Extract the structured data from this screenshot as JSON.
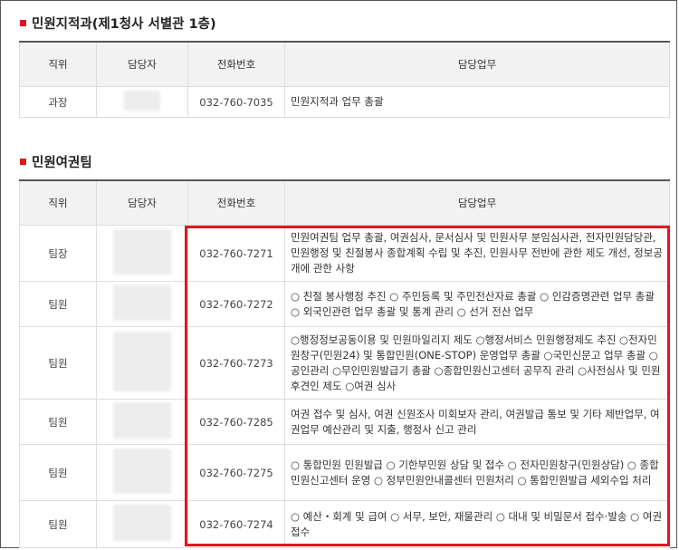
{
  "section1": {
    "title": "민원지적과(제1청사 서별관 1층)",
    "headers": [
      "직위",
      "담당자",
      "전화번호",
      "담당업무"
    ],
    "rows": [
      {
        "position": "과장",
        "phone": "032-760-7035",
        "duty": "민원지적과 업무 총괄"
      }
    ]
  },
  "section2": {
    "title": "민원여권팀",
    "headers": [
      "직위",
      "담당자",
      "전화번호",
      "담당업무"
    ],
    "rows": [
      {
        "position": "팀장",
        "phone": "032-760-7271",
        "duty": "민원여권팀 업무 총괄, 여권심사, 문서심사 및 민원사무 분임심사관, 전자민원담당관, 민원행정 및 친절봉사 종합계획 수립 및 추진, 민원사무 전반에 관한 제도 개선, 정보공개에 관한 사항"
      },
      {
        "position": "팀원",
        "phone": "032-760-7272",
        "duty": "○ 친절 봉사행정 추진 ○ 주민등록 및 주민전산자료 총괄 ○ 인감증명관련 업무 총괄 ○ 외국인관련 업무 총괄 및 통계 관리 ○ 선거 전산 업무"
      },
      {
        "position": "팀원",
        "phone": "032-760-7273",
        "duty": "○행정정보공동이용 및 민원마일리지 제도 ○행정서비스 민원행정제도 추진 ○전자민원창구(민원24) 및 통합민원(ONE-STOP) 운영업무 총괄 ○국민신문고 업무 총괄 ○공인관리 ○무인민원발급기 총괄 ○종합민원신고센터 공무직 관리 ○사전심사 및 민원후견인 제도 ○여권 심사"
      },
      {
        "position": "팀원",
        "phone": "032-760-7285",
        "duty": "여권 접수 및 심사, 여권 신원조사 미회보자 관리, 여권발급 통보 및 기타 제반업무, 여권업무 예산관리 및 지출, 행정사 신고 관리"
      },
      {
        "position": "팀원",
        "phone": "032-760-7275",
        "duty": "○ 통합민원 민원발급 ○ 기한부민원 상담 및 접수 ○ 전자민원창구(민원상담) ○ 종합민원신고센터 운영 ○ 정부민원안내콜센터 민원처리 ○ 통합민원발급 세외수입 처리"
      },
      {
        "position": "팀원",
        "phone": "032-760-7274",
        "duty": "○ 예산・회계 및 급여 ○ 서무, 보안, 재물관리 ○ 대내 및 비밀문서 접수·발송 ○ 여권 접수"
      }
    ]
  },
  "colors": {
    "accent": "#e0161c",
    "header_bg": "#f2f2f2",
    "border": "#dddddd"
  }
}
